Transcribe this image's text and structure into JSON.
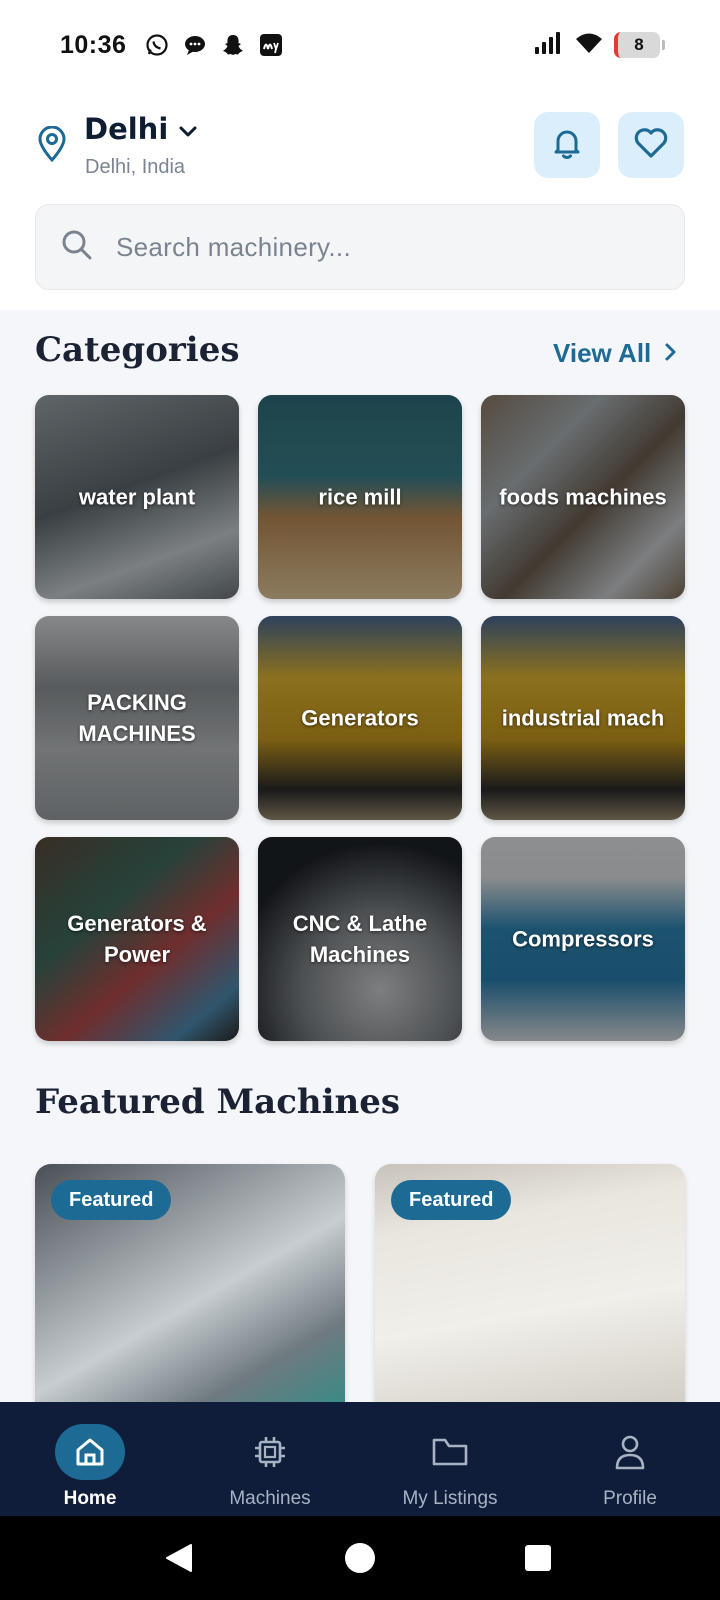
{
  "status_bar": {
    "time": "10:36",
    "notification_icons": [
      "whatsapp-icon",
      "chat-bubble-icon",
      "snapchat-icon",
      "my-app-icon"
    ],
    "battery_level": "8"
  },
  "header": {
    "city": "Delhi",
    "region": "Delhi, India"
  },
  "search": {
    "placeholder": "Search machinery..."
  },
  "categories": {
    "title": "Categories",
    "view_all_label": "View All",
    "items": [
      {
        "label": "water plant"
      },
      {
        "label": "rice mill"
      },
      {
        "label": "foods machines"
      },
      {
        "label": "PACKING\nMACHINES"
      },
      {
        "label": "Generators"
      },
      {
        "label": "industrial mach"
      },
      {
        "label": "Generators &\nPower"
      },
      {
        "label": "CNC & Lathe\nMachines"
      },
      {
        "label": "Compressors"
      }
    ]
  },
  "featured": {
    "title": "Featured Machines",
    "cards": [
      {
        "badge": "Featured"
      },
      {
        "badge": "Featured"
      }
    ]
  },
  "bottom_nav": {
    "items": [
      {
        "label": "Home",
        "icon": "home-icon",
        "active": true
      },
      {
        "label": "Machines",
        "icon": "chip-icon",
        "active": false
      },
      {
        "label": "My Listings",
        "icon": "folder-icon",
        "active": false
      },
      {
        "label": "Profile",
        "icon": "user-icon",
        "active": false
      }
    ]
  },
  "colors": {
    "accent": "#1d6a94",
    "nav_background": "#0f1d3a",
    "icon_button_bg": "#dbeefc"
  }
}
